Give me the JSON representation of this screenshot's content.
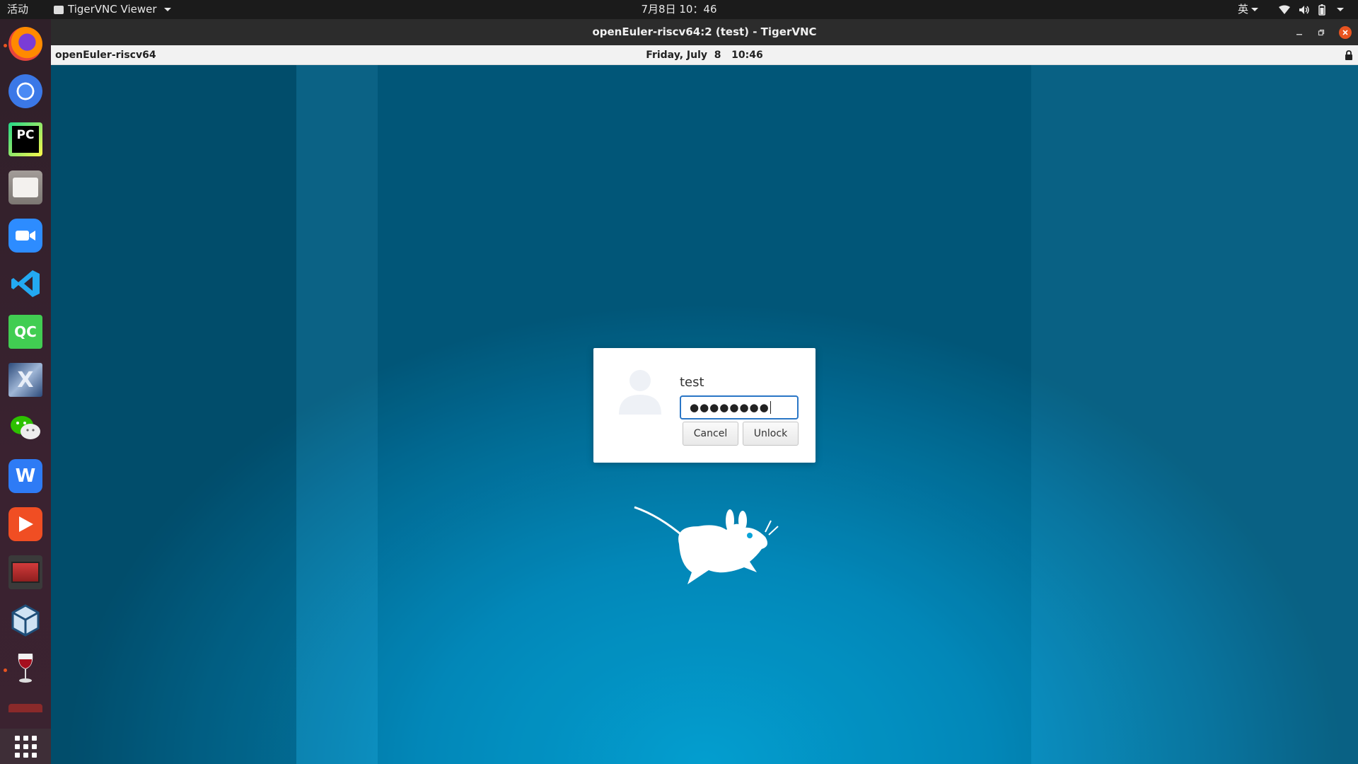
{
  "topbar": {
    "activities": "活动",
    "app_menu": "TigerVNC Viewer",
    "clock": "7月8日  10：46",
    "ime": "英"
  },
  "dock": {
    "items": [
      {
        "name": "firefox-icon",
        "running": true
      },
      {
        "name": "chromium-icon",
        "running": false
      },
      {
        "name": "pycharm-icon",
        "running": false,
        "text": "PC"
      },
      {
        "name": "files-icon",
        "running": false
      },
      {
        "name": "zoom-icon",
        "running": false
      },
      {
        "name": "vscode-icon",
        "running": false
      },
      {
        "name": "qtcreator-icon",
        "running": false,
        "text": "QC"
      },
      {
        "name": "xming-icon",
        "running": false,
        "text": "X"
      },
      {
        "name": "wechat-icon",
        "running": false
      },
      {
        "name": "wps-icon",
        "running": false,
        "text": "W"
      },
      {
        "name": "video-player-icon",
        "running": false
      },
      {
        "name": "terminal-app-icon",
        "running": false
      },
      {
        "name": "virtualbox-icon",
        "running": false
      },
      {
        "name": "wine-icon",
        "running": true
      }
    ]
  },
  "window": {
    "title": "openEuler-riscv64:2 (test) - TigerVNC"
  },
  "remote": {
    "hostname": "openEuler-riscv64",
    "datetime": "Friday, July  8   10:46"
  },
  "dialog": {
    "username": "test",
    "password_mask": "●●●●●●●●",
    "cancel_label": "Cancel",
    "unlock_label": "Unlock"
  },
  "colors": {
    "dock_bg": "#3a2230",
    "accent": "#e95420",
    "focus": "#2a76c6",
    "desktop": "#0390c4"
  }
}
